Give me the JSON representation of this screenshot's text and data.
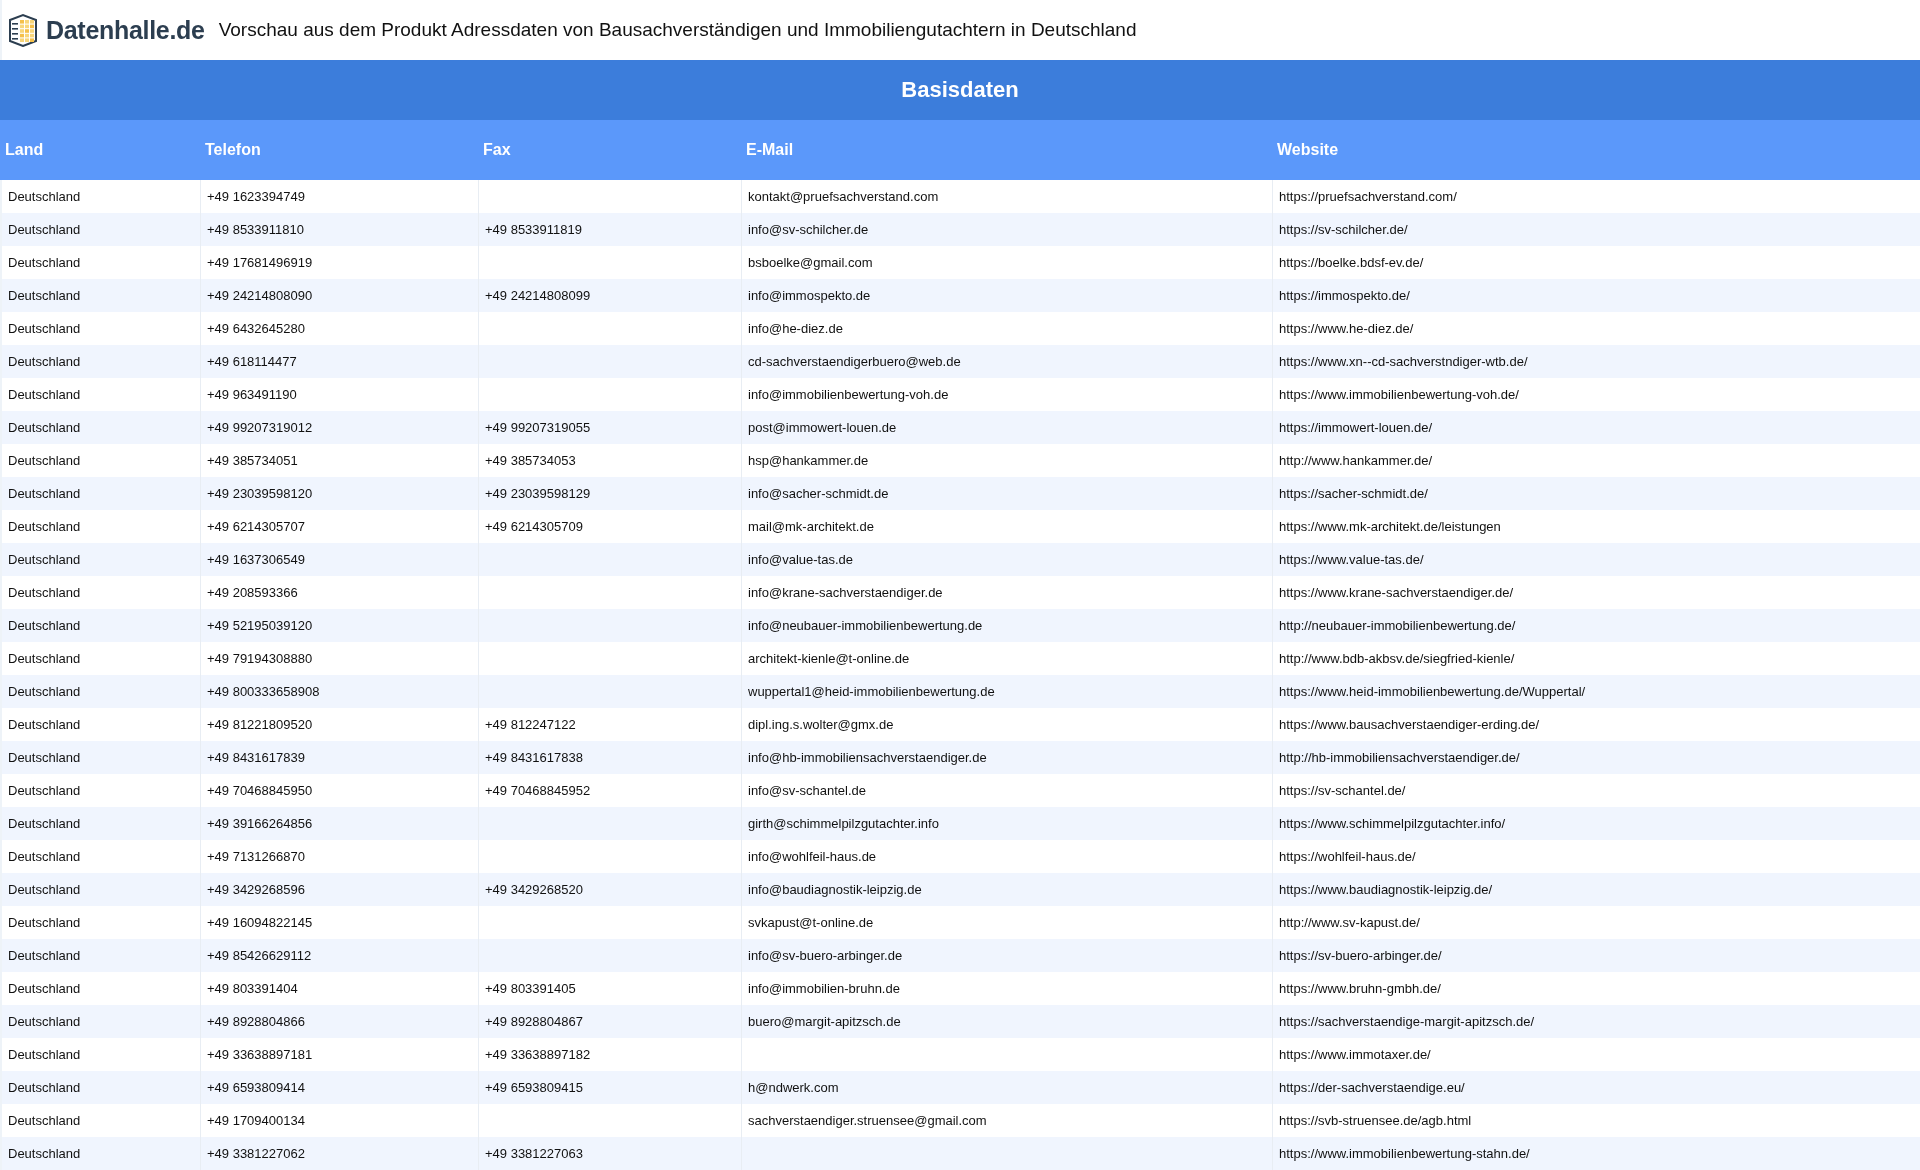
{
  "header": {
    "logo_text": "Datenhalle.de",
    "title": "Vorschau aus dem Produkt Adressdaten von Bausachverständigen und Immobiliengutachtern in Deutschland"
  },
  "table": {
    "title": "Basisdaten",
    "columns": [
      "Land",
      "Telefon",
      "Fax",
      "E-Mail",
      "Website"
    ],
    "rows": [
      {
        "land": "Deutschland",
        "telefon": "+49 1623394749",
        "email": "kontakt@pruefsachverstand.com",
        "website": "https://pruefsachverstand.com/"
      },
      {
        "land": "Deutschland",
        "telefon": "+49 8533911810",
        "fax": "+49 8533911819",
        "email": "info@sv-schilcher.de",
        "website": "https://sv-schilcher.de/"
      },
      {
        "land": "Deutschland",
        "telefon": "+49 17681496919",
        "email": "bsboelke@gmail.com",
        "website": "https://boelke.bdsf-ev.de/"
      },
      {
        "land": "Deutschland",
        "telefon": "+49 24214808090",
        "fax": "+49 24214808099",
        "email": "info@immospekto.de",
        "website": "https://immospekto.de/"
      },
      {
        "land": "Deutschland",
        "telefon": "+49 6432645280",
        "email": "info@he-diez.de",
        "website": "https://www.he-diez.de/"
      },
      {
        "land": "Deutschland",
        "telefon": "+49 618114477",
        "email": "cd-sachverstaendigerbuero@web.de",
        "website": "https://www.xn--cd-sachverstndiger-wtb.de/"
      },
      {
        "land": "Deutschland",
        "telefon": "+49 963491190",
        "email": "info@immobilienbewertung-voh.de",
        "website": "https://www.immobilienbewertung-voh.de/"
      },
      {
        "land": "Deutschland",
        "telefon": "+49 99207319012",
        "fax": "+49 99207319055",
        "email": "post@immowert-louen.de",
        "website": "https://immowert-louen.de/"
      },
      {
        "land": "Deutschland",
        "telefon": "+49 385734051",
        "fax": "+49 385734053",
        "email": "hsp@hankammer.de",
        "website": "http://www.hankammer.de/"
      },
      {
        "land": "Deutschland",
        "telefon": "+49 23039598120",
        "fax": "+49 23039598129",
        "email": "info@sacher-schmidt.de",
        "website": "https://sacher-schmidt.de/"
      },
      {
        "land": "Deutschland",
        "telefon": "+49 6214305707",
        "fax": "+49 6214305709",
        "email": "mail@mk-architekt.de",
        "website": "https://www.mk-architekt.de/leistungen"
      },
      {
        "land": "Deutschland",
        "telefon": "+49 1637306549",
        "email": "info@value-tas.de",
        "website": "https://www.value-tas.de/"
      },
      {
        "land": "Deutschland",
        "telefon": "+49 208593366",
        "email": "info@krane-sachverstaendiger.de",
        "website": "https://www.krane-sachverstaendiger.de/"
      },
      {
        "land": "Deutschland",
        "telefon": "+49 52195039120",
        "email": "info@neubauer-immobilienbewertung.de",
        "website": "http://neubauer-immobilienbewertung.de/"
      },
      {
        "land": "Deutschland",
        "telefon": "+49 79194308880",
        "email": "architekt-kienle@t-online.de",
        "website": "http://www.bdb-akbsv.de/siegfried-kienle/"
      },
      {
        "land": "Deutschland",
        "telefon": "+49 800333658908",
        "email": "wuppertal1@heid-immobilienbewertung.de",
        "website": "https://www.heid-immobilienbewertung.de/Wuppertal/"
      },
      {
        "land": "Deutschland",
        "telefon": "+49 81221809520",
        "fax": "+49 812247122",
        "email": "dipl.ing.s.wolter@gmx.de",
        "website": "https://www.bausachverstaendiger-erding.de/"
      },
      {
        "land": "Deutschland",
        "telefon": "+49 8431617839",
        "fax": "+49 8431617838",
        "email": "info@hb-immobiliensachverstaendiger.de",
        "website": "http://hb-immobiliensachverstaendiger.de/"
      },
      {
        "land": "Deutschland",
        "telefon": "+49 70468845950",
        "fax": "+49 70468845952",
        "email": "info@sv-schantel.de",
        "website": "https://sv-schantel.de/"
      },
      {
        "land": "Deutschland",
        "telefon": "+49 39166264856",
        "email": "girth@schimmelpilzgutachter.info",
        "website": "https://www.schimmelpilzgutachter.info/"
      },
      {
        "land": "Deutschland",
        "telefon": "+49 7131266870",
        "email": "info@wohlfeil-haus.de",
        "website": "https://wohlfeil-haus.de/"
      },
      {
        "land": "Deutschland",
        "telefon": "+49 3429268596",
        "fax": "+49 3429268520",
        "email": "info@baudiagnostik-leipzig.de",
        "website": "https://www.baudiagnostik-leipzig.de/"
      },
      {
        "land": "Deutschland",
        "telefon": "+49 16094822145",
        "email": "svkapust@t-online.de",
        "website": "http://www.sv-kapust.de/"
      },
      {
        "land": "Deutschland",
        "telefon": "+49 85426629112",
        "email": "info@sv-buero-arbinger.de",
        "website": "https://sv-buero-arbinger.de/"
      },
      {
        "land": "Deutschland",
        "telefon": "+49 803391404",
        "fax": "+49 803391405",
        "email": "info@immobilien-bruhn.de",
        "website": "https://www.bruhn-gmbh.de/"
      },
      {
        "land": "Deutschland",
        "telefon": "+49 8928804866",
        "fax": "+49 8928804867",
        "email": "buero@margit-apitzsch.de",
        "website": "https://sachverstaendige-margit-apitzsch.de/"
      },
      {
        "land": "Deutschland",
        "telefon": "+49 33638897181",
        "fax": "+49 33638897182",
        "website": "https://www.immotaxer.de/"
      },
      {
        "land": "Deutschland",
        "telefon": "+49 6593809414",
        "fax": "+49 6593809415",
        "email": "h@ndwerk.com",
        "website": "https://der-sachverstaendige.eu/"
      },
      {
        "land": "Deutschland",
        "telefon": "+49 1709400134",
        "email": "sachverstaendiger.struensee@gmail.com",
        "website": "https://svb-struensee.de/agb.html"
      },
      {
        "land": "Deutschland",
        "telefon": "+49 3381227062",
        "fax": "+49 3381227063",
        "website": "https://www.immobilienbewertung-stahn.de/"
      }
    ]
  }
}
